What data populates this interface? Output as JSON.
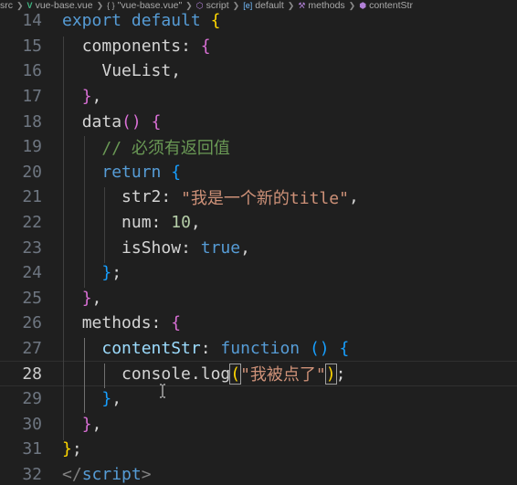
{
  "breadcrumb": {
    "items": [
      {
        "icon": "none",
        "label": "src"
      },
      {
        "icon": "vue-icon",
        "label": "vue-base.vue"
      },
      {
        "icon": "braces-icon",
        "label": "\"vue-base.vue\"",
        "prefix": "{ }"
      },
      {
        "icon": "script-icon",
        "label": "script"
      },
      {
        "icon": "field-icon",
        "label": "default"
      },
      {
        "icon": "method-icon",
        "label": "methods"
      },
      {
        "icon": "cube-icon",
        "label": "contentStr"
      }
    ]
  },
  "editor": {
    "current_line": 28,
    "lines": [
      {
        "num": "14",
        "tokens": [
          {
            "t": "export",
            "c": "kw"
          },
          {
            "t": " "
          },
          {
            "t": "default",
            "c": "kw"
          },
          {
            "t": " "
          },
          {
            "t": "{",
            "c": "b1"
          }
        ]
      },
      {
        "num": "15",
        "tokens": [
          {
            "t": "  "
          },
          {
            "t": "components",
            "c": "plain"
          },
          {
            "t": ": ",
            "c": "plain"
          },
          {
            "t": "{",
            "c": "b2"
          }
        ]
      },
      {
        "num": "16",
        "tokens": [
          {
            "t": "    "
          },
          {
            "t": "VueList",
            "c": "plain"
          },
          {
            "t": ",",
            "c": "plain"
          }
        ]
      },
      {
        "num": "17",
        "tokens": [
          {
            "t": "  "
          },
          {
            "t": "}",
            "c": "b2"
          },
          {
            "t": ",",
            "c": "plain"
          }
        ]
      },
      {
        "num": "18",
        "tokens": [
          {
            "t": "  "
          },
          {
            "t": "data",
            "c": "plain"
          },
          {
            "t": "()",
            "c": "b2"
          },
          {
            "t": " "
          },
          {
            "t": "{",
            "c": "b2"
          }
        ]
      },
      {
        "num": "19",
        "tokens": [
          {
            "t": "    "
          },
          {
            "t": "// 必须有返回值",
            "c": "com"
          }
        ]
      },
      {
        "num": "20",
        "tokens": [
          {
            "t": "    "
          },
          {
            "t": "return",
            "c": "kw"
          },
          {
            "t": " "
          },
          {
            "t": "{",
            "c": "b3"
          }
        ]
      },
      {
        "num": "21",
        "tokens": [
          {
            "t": "      "
          },
          {
            "t": "str2",
            "c": "plain"
          },
          {
            "t": ": ",
            "c": "plain"
          },
          {
            "t": "\"我是一个新的title\"",
            "c": "str"
          },
          {
            "t": ",",
            "c": "plain"
          }
        ]
      },
      {
        "num": "22",
        "tokens": [
          {
            "t": "      "
          },
          {
            "t": "num",
            "c": "plain"
          },
          {
            "t": ": ",
            "c": "plain"
          },
          {
            "t": "10",
            "c": "num"
          },
          {
            "t": ",",
            "c": "plain"
          }
        ]
      },
      {
        "num": "23",
        "tokens": [
          {
            "t": "      "
          },
          {
            "t": "isShow",
            "c": "plain"
          },
          {
            "t": ": ",
            "c": "plain"
          },
          {
            "t": "true",
            "c": "kw"
          },
          {
            "t": ",",
            "c": "plain"
          }
        ]
      },
      {
        "num": "24",
        "tokens": [
          {
            "t": "    "
          },
          {
            "t": "}",
            "c": "b3"
          },
          {
            "t": ";",
            "c": "plain"
          }
        ]
      },
      {
        "num": "25",
        "tokens": [
          {
            "t": "  "
          },
          {
            "t": "}",
            "c": "b2"
          },
          {
            "t": ",",
            "c": "plain"
          }
        ]
      },
      {
        "num": "26",
        "tokens": [
          {
            "t": "  "
          },
          {
            "t": "methods",
            "c": "plain"
          },
          {
            "t": ": ",
            "c": "plain"
          },
          {
            "t": "{",
            "c": "b2"
          }
        ]
      },
      {
        "num": "27",
        "tokens": [
          {
            "t": "    "
          },
          {
            "t": "contentStr",
            "c": "prop"
          },
          {
            "t": ": ",
            "c": "plain"
          },
          {
            "t": "function",
            "c": "kw"
          },
          {
            "t": " "
          },
          {
            "t": "()",
            "c": "b3"
          },
          {
            "t": " "
          },
          {
            "t": "{",
            "c": "b3"
          }
        ]
      },
      {
        "num": "28",
        "tokens": [
          {
            "t": "      "
          },
          {
            "t": "console",
            "c": "plain"
          },
          {
            "t": ".",
            "c": "plain"
          },
          {
            "t": "log",
            "c": "plain"
          },
          {
            "t": "(",
            "c": "b1",
            "box": true
          },
          {
            "t": "\"我被点了\"",
            "c": "str"
          },
          {
            "t": ")",
            "c": "b1",
            "box": true
          },
          {
            "t": ";",
            "c": "plain"
          }
        ]
      },
      {
        "num": "29",
        "tokens": [
          {
            "t": "    "
          },
          {
            "t": "}",
            "c": "b3"
          },
          {
            "t": ",",
            "c": "plain"
          }
        ]
      },
      {
        "num": "30",
        "tokens": [
          {
            "t": "  "
          },
          {
            "t": "}",
            "c": "b2"
          },
          {
            "t": ",",
            "c": "plain"
          }
        ]
      },
      {
        "num": "31",
        "tokens": [
          {
            "t": "}",
            "c": "b1"
          },
          {
            "t": ";",
            "c": "plain"
          }
        ]
      },
      {
        "num": "32",
        "tokens": [
          {
            "t": "</",
            "c": "gray"
          },
          {
            "t": "script",
            "c": "tag"
          },
          {
            "t": ">",
            "c": "gray"
          }
        ]
      }
    ]
  },
  "colors": {
    "background": "#1f1f1f",
    "keyword": "#569cd6",
    "string": "#ce9178",
    "number": "#b5cea8",
    "comment": "#6a9955",
    "bracket_level1": "#ffd700",
    "bracket_level2": "#da70d6",
    "bracket_level3": "#179fff"
  }
}
